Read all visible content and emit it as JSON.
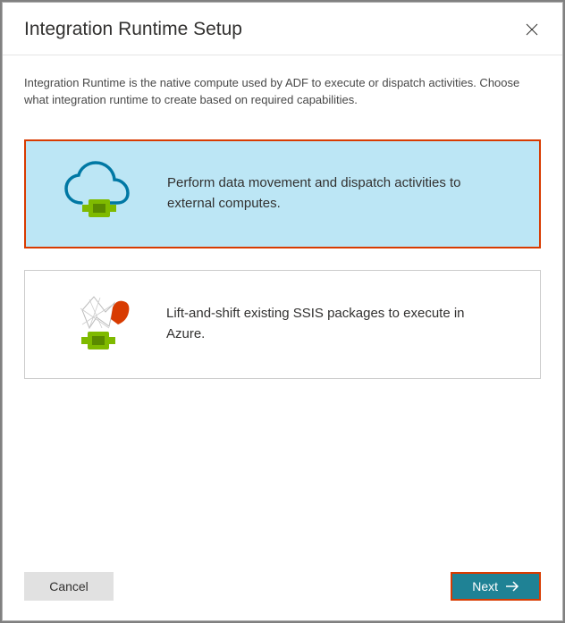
{
  "header": {
    "title": "Integration Runtime Setup"
  },
  "description": "Integration Runtime is the native compute used by ADF to execute or dispatch activities. Choose what integration runtime to create based on required capabilities.",
  "options": [
    {
      "text": "Perform data movement and dispatch activities to external computes.",
      "selected": true
    },
    {
      "text": "Lift-and-shift existing SSIS packages to execute in Azure.",
      "selected": false
    }
  ],
  "footer": {
    "cancel_label": "Cancel",
    "next_label": "Next"
  }
}
